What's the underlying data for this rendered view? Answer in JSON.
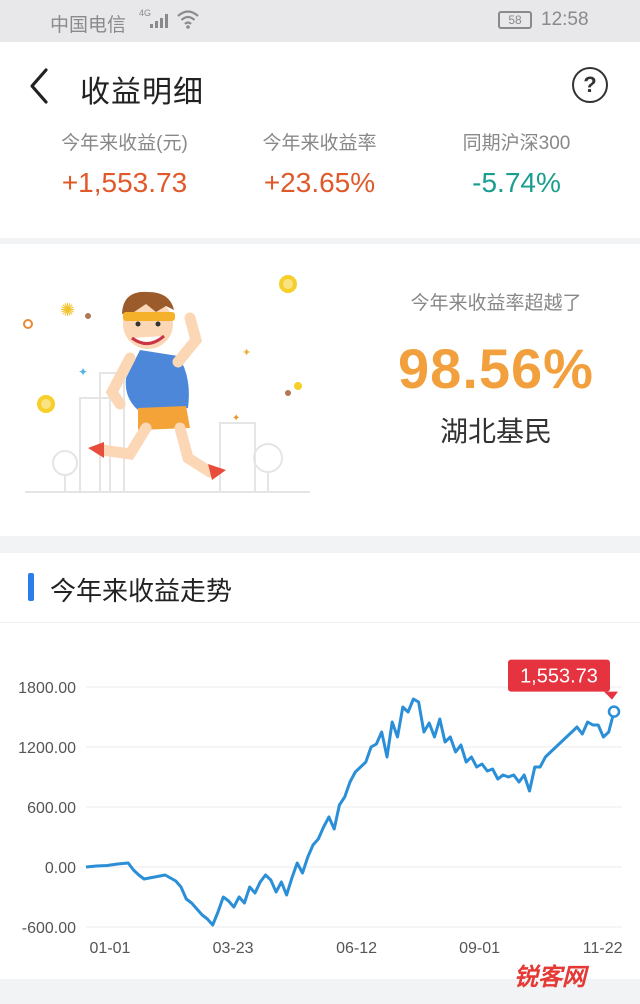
{
  "status_bar": {
    "carrier": "中国电信",
    "network": "4G",
    "battery": "58",
    "time": "12:58"
  },
  "nav": {
    "title": "收益明细",
    "help": "?"
  },
  "summary": [
    {
      "label": "今年来收益(元)",
      "value": "+1,553.73",
      "color": "#e0592a"
    },
    {
      "label": "今年来收益率",
      "value": "+23.65%",
      "color": "#e0592a"
    },
    {
      "label": "同期沪深300",
      "value": "-5.74%",
      "color": "#1a9e8f"
    }
  ],
  "ranking": {
    "caption": "今年来收益率超越了",
    "percent": "98.56%",
    "group": "湖北基民"
  },
  "trend": {
    "title": "今年来收益走势",
    "accent": "#2b7de9"
  },
  "chart_data": {
    "type": "line",
    "ylim": [
      -600,
      1800
    ],
    "y_ticks": [
      "1800.00",
      "1200.00",
      "600.00",
      "0.00",
      "-600.00"
    ],
    "y_tick_values": [
      1800,
      1200,
      600,
      0,
      -600
    ],
    "x_ticks": [
      "01-01",
      "03-23",
      "06-12",
      "09-01",
      "11-22"
    ],
    "x_tick_positions": [
      0,
      0.233,
      0.467,
      0.7,
      0.933
    ],
    "grid": true,
    "line_color": "#2b8fd8",
    "callout": {
      "text": "1,553.73",
      "color": "#e53340"
    },
    "series": [
      {
        "x": [
          0,
          0.02,
          0.04,
          0.06,
          0.08,
          0.09,
          0.1,
          0.11,
          0.13,
          0.15,
          0.17,
          0.18,
          0.19,
          0.2,
          0.21,
          0.22,
          0.23,
          0.24,
          0.25,
          0.26,
          0.27,
          0.28,
          0.29,
          0.3,
          0.31,
          0.32,
          0.33,
          0.34,
          0.35,
          0.36,
          0.37,
          0.38,
          0.39,
          0.4,
          0.41,
          0.42,
          0.43,
          0.44,
          0.45,
          0.46,
          0.47,
          0.48,
          0.49,
          0.5,
          0.51,
          0.52,
          0.53,
          0.54,
          0.55,
          0.56,
          0.57,
          0.58,
          0.59,
          0.6,
          0.61,
          0.62,
          0.63,
          0.64,
          0.65,
          0.66,
          0.67,
          0.68,
          0.69,
          0.7,
          0.71,
          0.72,
          0.73,
          0.74,
          0.75,
          0.76,
          0.77,
          0.78,
          0.79,
          0.8,
          0.81,
          0.82,
          0.83,
          0.84,
          0.85,
          0.86,
          0.87,
          0.88,
          0.89,
          0.9,
          0.91,
          0.92,
          0.93,
          0.94,
          0.95,
          0.96,
          0.97,
          0.98,
          0.99,
          1.0
        ],
        "y": [
          0,
          10,
          15,
          30,
          40,
          -30,
          -80,
          -120,
          -100,
          -80,
          -140,
          -200,
          -320,
          -360,
          -420,
          -480,
          -520,
          -580,
          -450,
          -300,
          -340,
          -400,
          -300,
          -360,
          -200,
          -260,
          -150,
          -80,
          -130,
          -250,
          -150,
          -280,
          -110,
          40,
          -60,
          100,
          220,
          280,
          400,
          500,
          380,
          620,
          700,
          850,
          950,
          1000,
          1050,
          1200,
          1230,
          1350,
          1100,
          1450,
          1300,
          1600,
          1550,
          1680,
          1650,
          1350,
          1440,
          1300,
          1480,
          1250,
          1300,
          1150,
          1220,
          1050,
          1100,
          1000,
          1030,
          960,
          980,
          880,
          920,
          900,
          920,
          850,
          920,
          760,
          1000,
          1000,
          1100,
          1150,
          1200,
          1250,
          1300,
          1350,
          1400,
          1330,
          1450,
          1420,
          1420,
          1300,
          1350,
          1553.73
        ]
      }
    ]
  }
}
